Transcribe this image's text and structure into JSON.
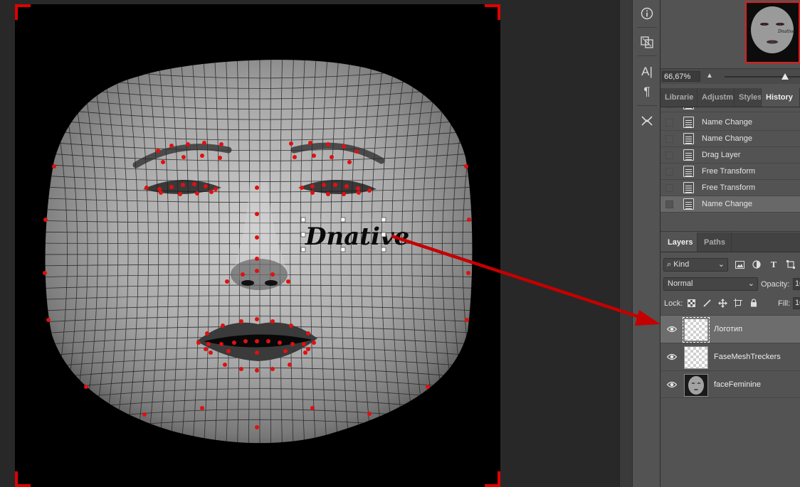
{
  "canvas": {
    "watermark_text": "Dnative",
    "crop_color": "#e00000",
    "annotation_arrow_color": "#c40000",
    "tracker_dot_color": "#e01010"
  },
  "toolbar": {
    "icons": [
      "info-icon",
      "navigator-icon",
      "character-icon",
      "paragraph-icon",
      "tools-icon"
    ],
    "character_glyph": "A|",
    "paragraph_glyph": "¶"
  },
  "navigator": {
    "zoom": "66,67%",
    "highlight_color": "#e41b1b"
  },
  "history_panel": {
    "tabs": [
      "Librarie",
      "Adjustm",
      "Styles",
      "History"
    ],
    "active_tab": "History",
    "items": [
      {
        "label": "Name Change",
        "selected": false
      },
      {
        "label": "Name Change",
        "selected": false
      },
      {
        "label": "Drag Layer",
        "selected": false
      },
      {
        "label": "Free Transform",
        "selected": false
      },
      {
        "label": "Free Transform",
        "selected": false
      },
      {
        "label": "Name Change",
        "selected": true
      }
    ]
  },
  "layers_panel": {
    "tabs": [
      "Layers",
      "Paths"
    ],
    "active_tab": "Layers",
    "kind_label": "Kind",
    "blend_mode": "Normal",
    "opacity_label": "Opacity:",
    "opacity_value": "10",
    "lock_label": "Lock:",
    "fill_label": "Fill:",
    "fill_value": "10",
    "layers": [
      {
        "name": "Логотип",
        "selected": true,
        "thumb": "transparent"
      },
      {
        "name": "FaseMeshTreckers",
        "selected": false,
        "thumb": "transparent"
      },
      {
        "name": "faceFeminine",
        "selected": false,
        "thumb": "face"
      }
    ]
  }
}
